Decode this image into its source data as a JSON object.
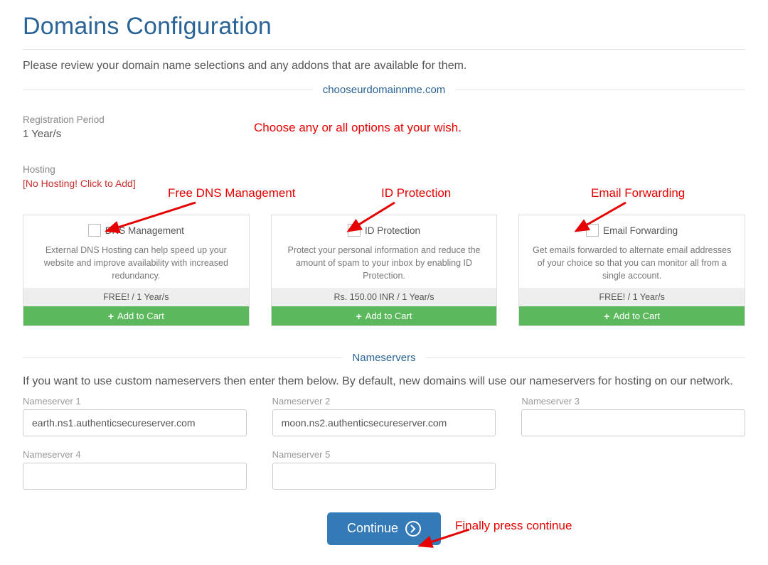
{
  "title": "Domains Configuration",
  "intro": "Please review your domain name selections and any addons that are available for them.",
  "domain_name": "chooseurdomainnme.com",
  "registration": {
    "label": "Registration Period",
    "value": "1 Year/s"
  },
  "hosting": {
    "label": "Hosting",
    "none_text": "[No Hosting! Click to Add]"
  },
  "addons": [
    {
      "title": "DNS Management",
      "desc": "External DNS Hosting can help speed up your website and improve availability with increased redundancy.",
      "price": "FREE! / 1 Year/s",
      "btn": "Add to Cart"
    },
    {
      "title": "ID Protection",
      "desc": "Protect your personal information and reduce the amount of spam to your inbox by enabling ID Protection.",
      "price": "Rs. 150.00 INR / 1 Year/s",
      "btn": "Add to Cart"
    },
    {
      "title": "Email Forwarding",
      "desc": "Get emails forwarded to alternate email addresses of your choice so that you can monitor all from a single account.",
      "price": "FREE! / 1 Year/s",
      "btn": "Add to Cart"
    }
  ],
  "nameservers": {
    "heading": "Nameservers",
    "desc": "If you want to use custom nameservers then enter them below. By default, new domains will use our nameservers for hosting on our network.",
    "fields": [
      {
        "label": "Nameserver 1",
        "value": "earth.ns1.authenticsecureserver.com"
      },
      {
        "label": "Nameserver 2",
        "value": "moon.ns2.authenticsecureserver.com"
      },
      {
        "label": "Nameserver 3",
        "value": ""
      },
      {
        "label": "Nameserver 4",
        "value": ""
      },
      {
        "label": "Nameserver 5",
        "value": ""
      }
    ]
  },
  "continue_label": "Continue",
  "annotations": {
    "top": "Choose any or all options at your wish.",
    "dns": "Free DNS Management",
    "idp": "ID Protection",
    "email": "Email Forwarding",
    "cont": "Finally press continue"
  }
}
